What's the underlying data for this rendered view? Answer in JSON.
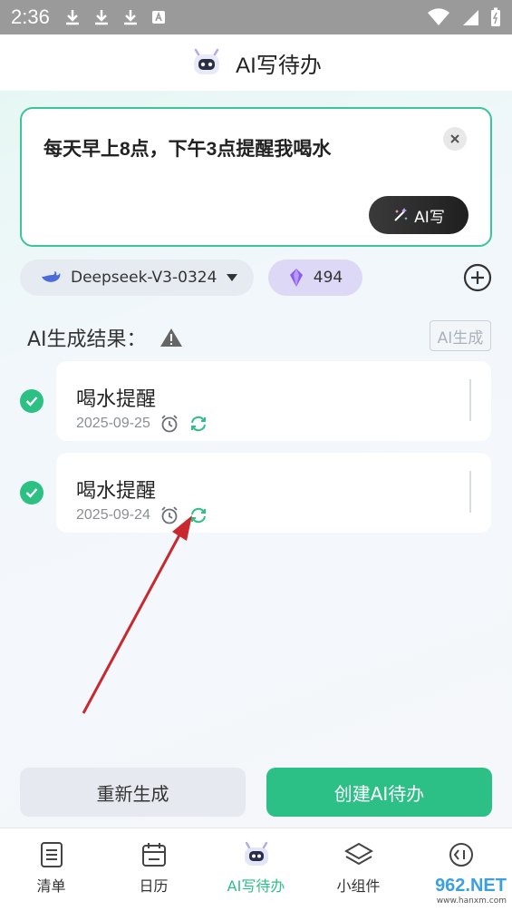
{
  "status_bar": {
    "time": "2:36"
  },
  "header": {
    "title": "AI写待办"
  },
  "input": {
    "text": "每天早上8点，下午3点提醒我喝水",
    "ai_write_label": "AI写"
  },
  "model_selector": {
    "value": "Deepseek-V3-0324"
  },
  "points": {
    "value": "494"
  },
  "results": {
    "label": "AI生成结果：",
    "ai_generate_label": "AI生成",
    "items": [
      {
        "title": "喝水提醒",
        "date": "2025-09-25",
        "checked": true
      },
      {
        "title": "喝水提醒",
        "date": "2025-09-24",
        "checked": true
      }
    ]
  },
  "actions": {
    "regenerate_label": "重新生成",
    "create_label": "创建AI待办"
  },
  "bottom_nav": {
    "items": [
      {
        "label": "清单",
        "icon": "list-icon",
        "active": false
      },
      {
        "label": "日历",
        "icon": "calendar-icon",
        "active": false
      },
      {
        "label": "AI写待办",
        "icon": "robot-icon",
        "active": true
      },
      {
        "label": "小组件",
        "icon": "layers-icon",
        "active": false
      },
      {
        "label": "",
        "icon": "more-icon",
        "active": false
      }
    ]
  },
  "watermark": {
    "text": "962.NET",
    "sub": "www.hanxm.com"
  },
  "colors": {
    "accent": "#2cbf86",
    "border": "#3cc49a",
    "points_bg": "#ded8f7",
    "model_bg": "#e6ebf2"
  }
}
